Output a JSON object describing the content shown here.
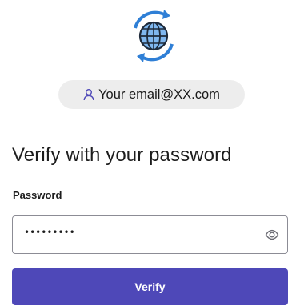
{
  "identity": {
    "email": "Your email@XX.com",
    "icon": "user-icon"
  },
  "heading": "Verify with your password",
  "password_field": {
    "label": "Password",
    "masked_value": "•••••••••",
    "toggle_icon": "eye-icon"
  },
  "verify_button": {
    "label": "Verify"
  },
  "colors": {
    "accent": "#4e48b8",
    "logo_ring": "#2f7fd6",
    "logo_fill": "#7fb7ef",
    "chip_bg": "#ededed"
  },
  "logo_icon": "globe-refresh-icon"
}
